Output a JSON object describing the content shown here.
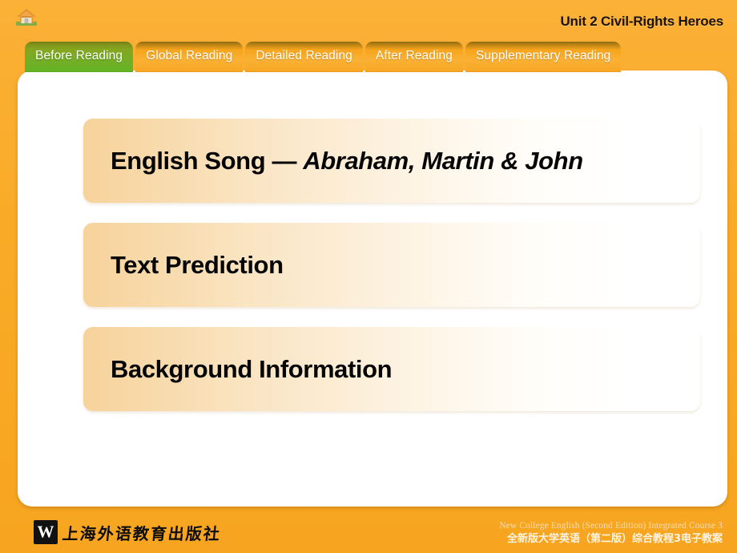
{
  "header": {
    "home_icon": "home-icon",
    "unit_title": "Unit 2 Civil-Rights Heroes"
  },
  "tabs": [
    {
      "label": "Before Reading",
      "active": true,
      "name": "tab-before-reading"
    },
    {
      "label": "Global Reading",
      "active": false,
      "name": "tab-global-reading"
    },
    {
      "label": "Detailed Reading",
      "active": false,
      "name": "tab-detailed-reading"
    },
    {
      "label": "After Reading",
      "active": false,
      "name": "tab-after-reading"
    },
    {
      "label": "Supplementary Reading",
      "active": false,
      "name": "tab-supplementary-reading"
    }
  ],
  "sections": [
    {
      "prefix": "English Song — ",
      "emphasis": "Abraham, Martin & John",
      "name": "section-english-song"
    },
    {
      "prefix": "Text Prediction",
      "emphasis": "",
      "name": "section-text-prediction"
    },
    {
      "prefix": "Background Information",
      "emphasis": "",
      "name": "section-background-information"
    }
  ],
  "footer": {
    "logo_letter": "W",
    "publisher_name": "上海外语教育出版社",
    "course_en": "New College English (Second Edition) Integrated Course 3",
    "course_zh": "全新版大学英语（第二版）综合教程3电子教案"
  },
  "colors": {
    "background_orange": "#f9ae2e",
    "active_tab_green": "#7aa820",
    "inactive_tab_orange": "#f7a623",
    "panel_white": "#ffffff",
    "section_gradient_start": "#f7d39b",
    "title_text": "#1b1208"
  }
}
